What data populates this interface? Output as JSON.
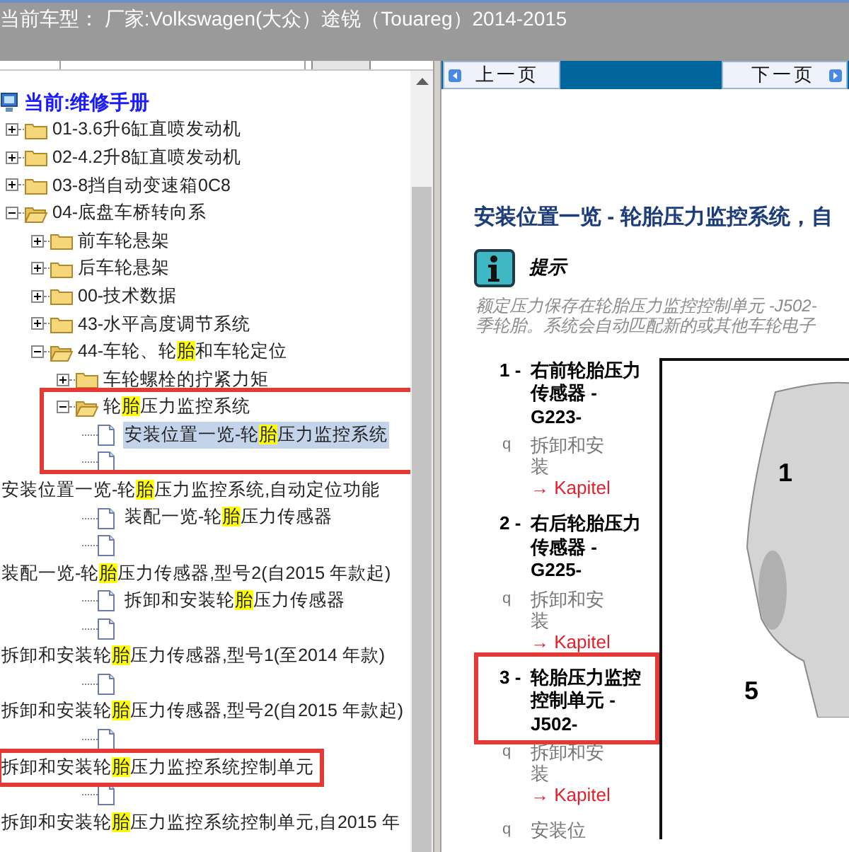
{
  "title": "当前车型： 厂家:Volkswagen(大众）途锐（Touareg）2014-2015",
  "tree": {
    "root": "当前:维修手册",
    "items": [
      {
        "kind": "folder",
        "expanded": false,
        "parts": [
          {
            "text": "01-3.6升6缸直喷发动机",
            "highlighted": false
          }
        ]
      },
      {
        "kind": "folder",
        "expanded": false,
        "parts": [
          {
            "text": "02-4.2升8缸直喷发动机",
            "highlighted": false
          }
        ]
      },
      {
        "kind": "folder",
        "expanded": false,
        "parts": [
          {
            "text": "03-8挡自动变速箱0C8",
            "highlighted": false
          }
        ]
      },
      {
        "kind": "folder",
        "expanded": true,
        "parts": [
          {
            "text": "04-底盘车桥转向系",
            "highlighted": false
          }
        ],
        "children": [
          {
            "kind": "folder",
            "expanded": false,
            "parts": [
              {
                "text": "前车轮悬架",
                "highlighted": false
              }
            ]
          },
          {
            "kind": "folder",
            "expanded": false,
            "parts": [
              {
                "text": "后车轮悬架",
                "highlighted": false
              }
            ]
          },
          {
            "kind": "folder",
            "expanded": false,
            "parts": [
              {
                "text": "00-技术数据",
                "highlighted": false
              }
            ]
          },
          {
            "kind": "folder",
            "expanded": false,
            "parts": [
              {
                "text": "43-水平高度调节系统",
                "highlighted": false
              }
            ]
          },
          {
            "kind": "folder",
            "expanded": true,
            "parts": [
              {
                "text": "44-车轮、轮",
                "highlighted": false
              },
              {
                "text": "胎",
                "highlighted": true
              },
              {
                "text": "和车轮定位",
                "highlighted": false
              }
            ],
            "children": [
              {
                "kind": "folder",
                "expanded": false,
                "parts": [
                  {
                    "text": "车轮螺栓的拧紧力矩",
                    "highlighted": false
                  }
                ]
              },
              {
                "kind": "folder",
                "expanded": true,
                "parts": [
                  {
                    "text": "轮",
                    "highlighted": false
                  },
                  {
                    "text": "胎",
                    "highlighted": true
                  },
                  {
                    "text": "压力监控系统",
                    "highlighted": false
                  }
                ],
                "children": [
                  {
                    "kind": "document",
                    "selected": true,
                    "parts": [
                      {
                        "text": "安装位置一览-轮",
                        "highlighted": false
                      },
                      {
                        "text": "胎",
                        "highlighted": true
                      },
                      {
                        "text": "压力监控系统",
                        "highlighted": false
                      }
                    ]
                  },
                  {
                    "kind": "document",
                    "selected": false,
                    "parts": [
                      {
                        "text": "安装位置一览-轮",
                        "highlighted": false
                      },
                      {
                        "text": "胎",
                        "highlighted": true
                      },
                      {
                        "text": "压力监控系统,自动定位功能",
                        "highlighted": false
                      }
                    ]
                  },
                  {
                    "kind": "document",
                    "selected": false,
                    "parts": [
                      {
                        "text": "装配一览-轮",
                        "highlighted": false
                      },
                      {
                        "text": "胎",
                        "highlighted": true
                      },
                      {
                        "text": "压力传感器",
                        "highlighted": false
                      }
                    ]
                  },
                  {
                    "kind": "document",
                    "selected": false,
                    "parts": [
                      {
                        "text": "装配一览-轮",
                        "highlighted": false
                      },
                      {
                        "text": "胎",
                        "highlighted": true
                      },
                      {
                        "text": "压力传感器,型号2(自2015 年款起)",
                        "highlighted": false
                      }
                    ]
                  },
                  {
                    "kind": "document",
                    "selected": false,
                    "parts": [
                      {
                        "text": "拆卸和安装轮",
                        "highlighted": false
                      },
                      {
                        "text": "胎",
                        "highlighted": true
                      },
                      {
                        "text": "压力传感器",
                        "highlighted": false
                      }
                    ]
                  },
                  {
                    "kind": "document",
                    "selected": false,
                    "parts": [
                      {
                        "text": "拆卸和安装轮",
                        "highlighted": false
                      },
                      {
                        "text": "胎",
                        "highlighted": true
                      },
                      {
                        "text": "压力传感器,型号1(至2014 年款)",
                        "highlighted": false
                      }
                    ]
                  },
                  {
                    "kind": "document",
                    "selected": false,
                    "parts": [
                      {
                        "text": "拆卸和安装轮",
                        "highlighted": false
                      },
                      {
                        "text": "胎",
                        "highlighted": true
                      },
                      {
                        "text": "压力传感器,型号2(自2015 年款起)",
                        "highlighted": false
                      }
                    ]
                  },
                  {
                    "kind": "document",
                    "selected": false,
                    "parts": [
                      {
                        "text": "拆卸和安装轮",
                        "highlighted": false
                      },
                      {
                        "text": "胎",
                        "highlighted": true
                      },
                      {
                        "text": "压力监控系统控制单元",
                        "highlighted": false
                      }
                    ]
                  },
                  {
                    "kind": "document",
                    "selected": false,
                    "parts": [
                      {
                        "text": "拆卸和安装轮",
                        "highlighted": false
                      },
                      {
                        "text": "胎",
                        "highlighted": true
                      },
                      {
                        "text": "压力监控系统控制单元,自2015 年",
                        "highlighted": false
                      }
                    ]
                  }
                ]
              }
            ]
          }
        ]
      }
    ]
  },
  "page": {
    "nav": [
      {
        "label": "上一页"
      },
      {
        "label": "下一页"
      }
    ],
    "heading": "安装位置一览 - 轮胎压力监控系统，自",
    "note": {
      "title": "提示",
      "lines": [
        "额定压力保存在轮胎压力监控控制单元 -J502-",
        "季轮胎。系统会自动匹配新的或其他车轮电子"
      ]
    },
    "legend": [
      {
        "number": "1 -",
        "label": "右前轮胎压力传感器 -G223-",
        "links": [
          {
            "bullet": "q",
            "text": "拆卸和安装",
            "ref": "→ Kapitel"
          }
        ]
      },
      {
        "number": "2 -",
        "label": "右后轮胎压力传感器 -G225-",
        "links": [
          {
            "bullet": "q",
            "text": "拆卸和安装",
            "ref": "→ Kapitel"
          }
        ]
      },
      {
        "number": "3 -",
        "label": "轮胎压力监控控制单元 -J502-",
        "links": [
          {
            "bullet": "q",
            "text": "拆卸和安装",
            "ref": "→ Kapitel"
          },
          {
            "bullet": "q",
            "text": "安装位"
          }
        ]
      }
    ],
    "illustration": {
      "callouts": [
        "1",
        "5"
      ]
    }
  }
}
